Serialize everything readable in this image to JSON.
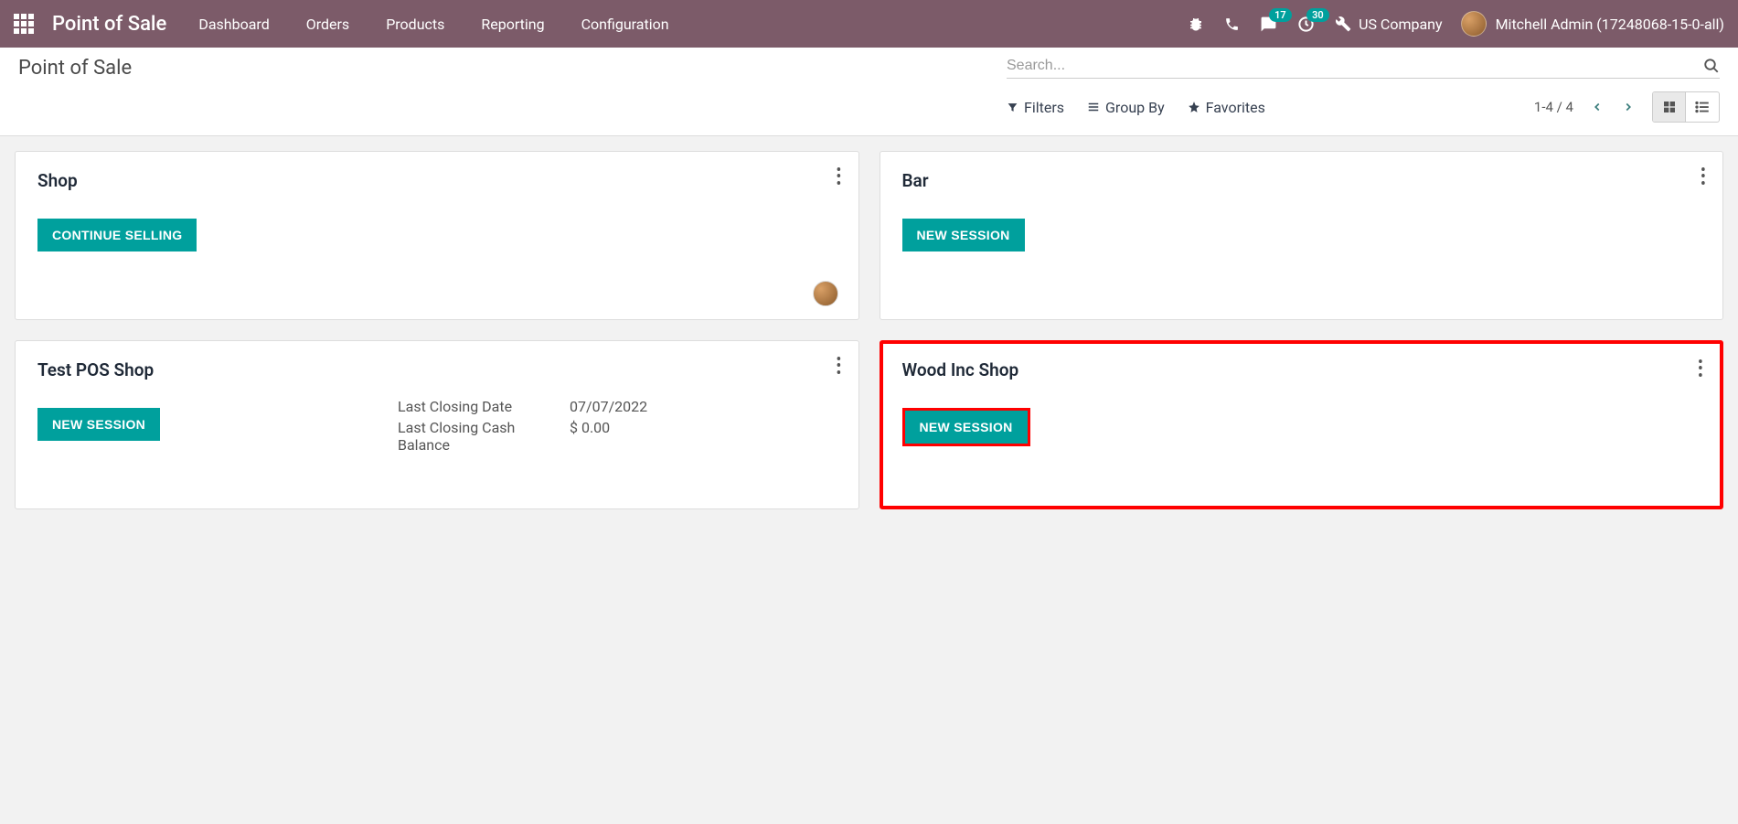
{
  "navbar": {
    "brand": "Point of Sale",
    "menu": [
      "Dashboard",
      "Orders",
      "Products",
      "Reporting",
      "Configuration"
    ],
    "messages_badge": "17",
    "activities_badge": "30",
    "company": "US Company",
    "user": "Mitchell Admin (17248068-15-0-all)"
  },
  "header": {
    "title": "Point of Sale",
    "search_placeholder": "Search...",
    "filters_label": "Filters",
    "groupby_label": "Group By",
    "favorites_label": "Favorites",
    "pager": "1-4 / 4"
  },
  "cards": [
    {
      "title": "Shop",
      "button": "CONTINUE SELLING",
      "has_avatar": true
    },
    {
      "title": "Bar",
      "button": "NEW SESSION"
    },
    {
      "title": "Test POS Shop",
      "button": "NEW SESSION",
      "details": {
        "closing_date_label": "Last Closing Date",
        "closing_date_value": "07/07/2022",
        "cash_label": "Last Closing Cash Balance",
        "cash_value": "$ 0.00"
      }
    },
    {
      "title": "Wood Inc Shop",
      "button": "NEW SESSION",
      "highlighted": true
    }
  ]
}
